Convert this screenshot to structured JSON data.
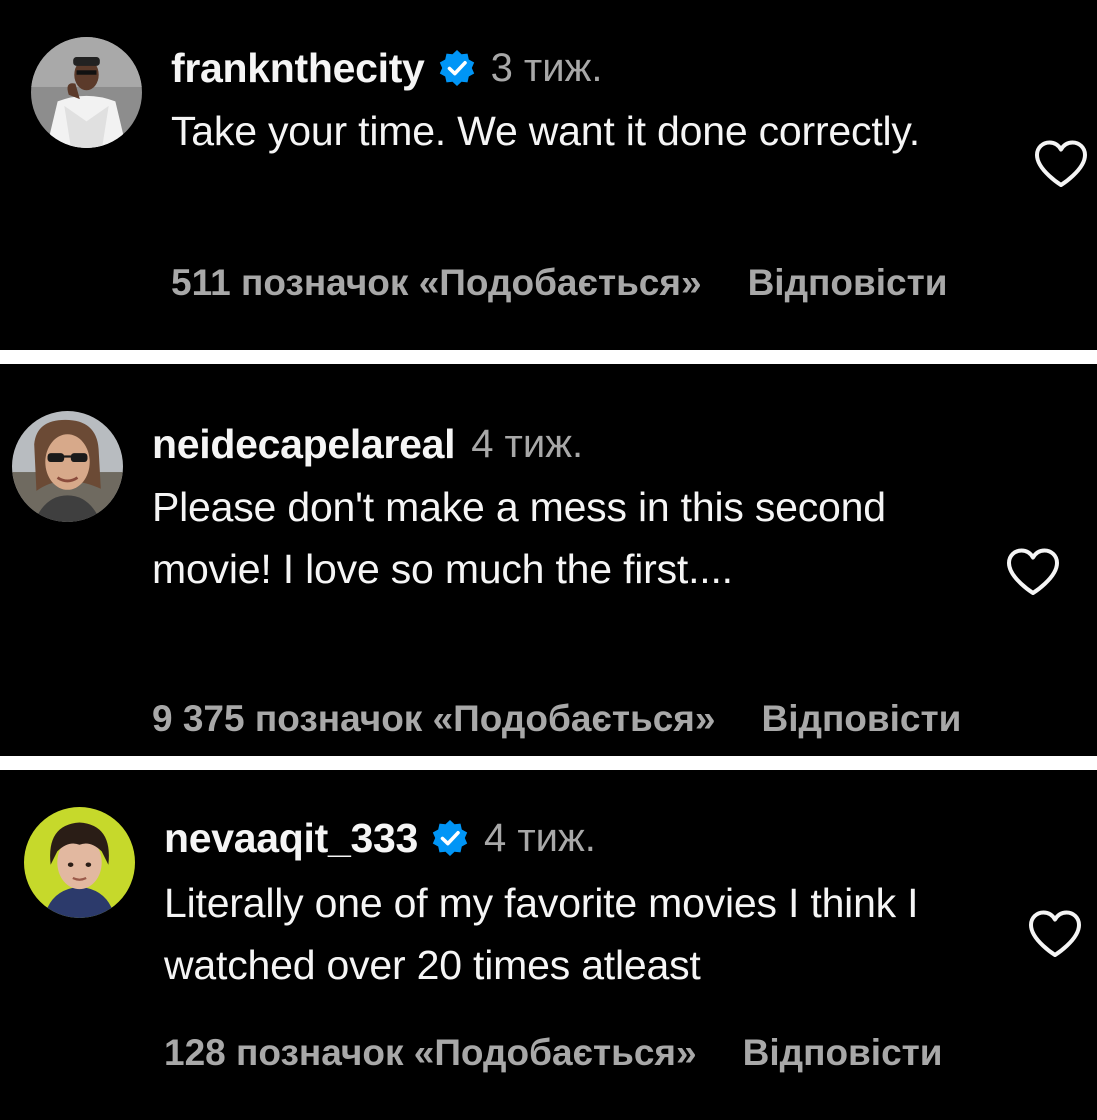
{
  "comments": [
    {
      "username": "franknthecity",
      "verified": true,
      "time": "3 тиж.",
      "text": "Take your time. We want it done correctly.",
      "likes_label": "511 позначок «Подобається»",
      "reply_label": "Відповісти",
      "avatar_icon": "avatar-man-white-shirt"
    },
    {
      "username": "neidecapelareal",
      "verified": false,
      "time": "4 тиж.",
      "text": "Please don't make a mess in this second movie! I love so much the first....",
      "likes_label": "9 375 позначок «Подобається»",
      "reply_label": "Відповісти",
      "avatar_icon": "avatar-woman-sunglasses"
    },
    {
      "username": "nevaaqit_333",
      "verified": true,
      "time": "4 тиж.",
      "text": "Literally one of my favorite movies I think I watched over 20 times atleast",
      "likes_label": "128 позначок «Подобається»",
      "reply_label": "Відповісти",
      "avatar_icon": "avatar-dark-hair-green-bg"
    }
  ],
  "colors": {
    "background": "#000000",
    "separator": "#ffffff",
    "primary_text": "#f5f5f5",
    "secondary_text": "#a8a8a8",
    "verified_badge": "#0095f6"
  },
  "icons": {
    "verified": "verified-badge-icon",
    "like": "heart-outline-icon"
  }
}
